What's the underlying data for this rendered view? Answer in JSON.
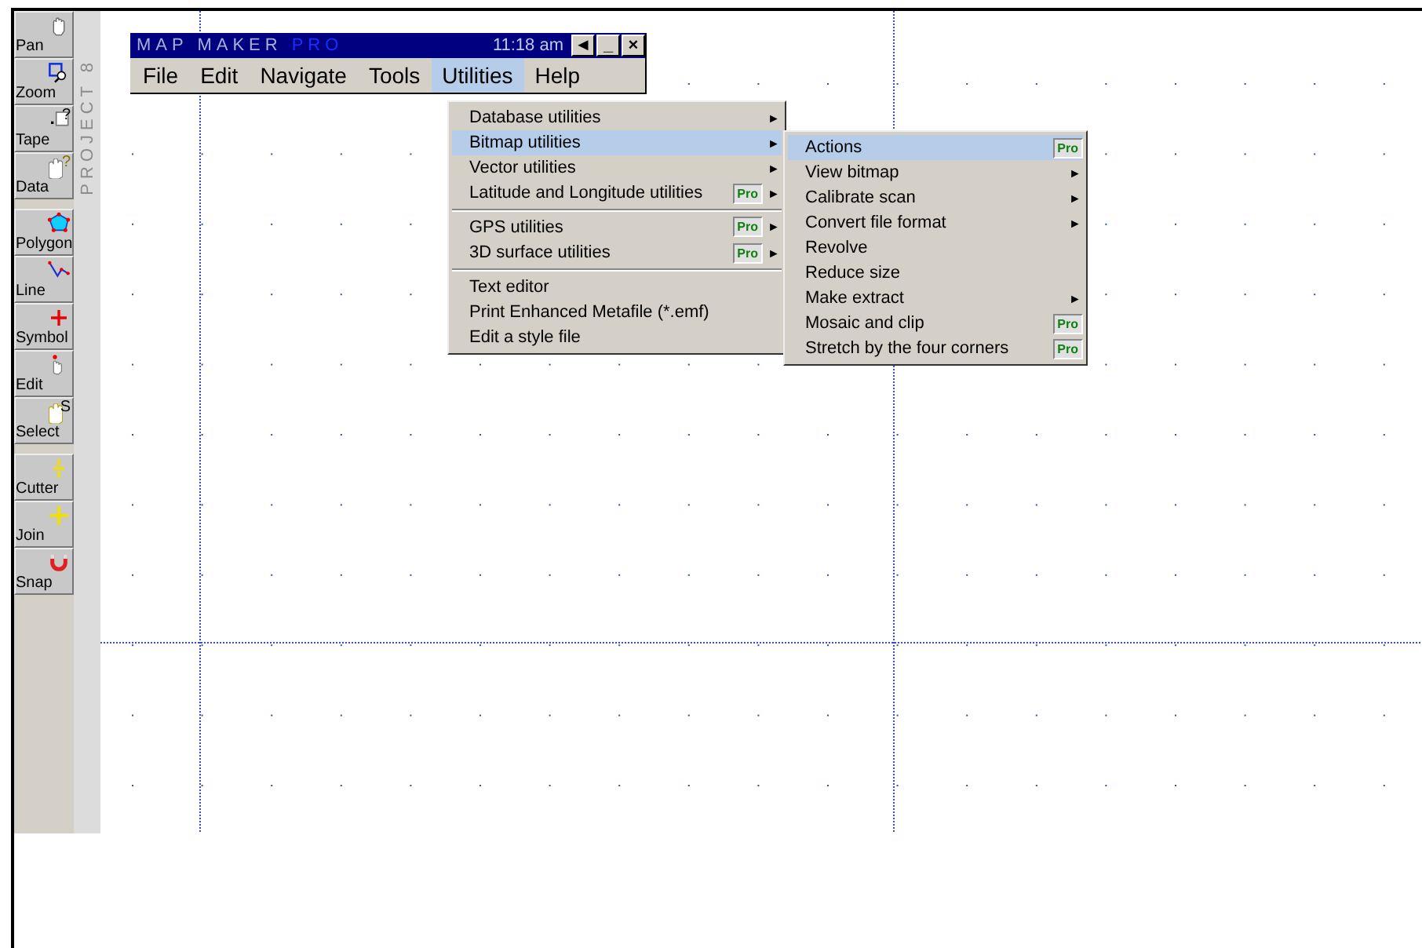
{
  "toolbar": {
    "groups": [
      {
        "buttons": [
          {
            "label": "Pan"
          },
          {
            "label": "Zoom"
          },
          {
            "label": "Tape",
            "badge": "?"
          },
          {
            "label": "Data",
            "badge": "?"
          }
        ]
      },
      {
        "buttons": [
          {
            "label": "Polygon"
          },
          {
            "label": "Line"
          },
          {
            "label": "Symbol"
          },
          {
            "label": "Edit"
          },
          {
            "label": "Select",
            "badge": "S"
          }
        ]
      },
      {
        "buttons": [
          {
            "label": "Cutter"
          },
          {
            "label": "Join"
          },
          {
            "label": "Snap"
          }
        ]
      }
    ]
  },
  "side_strip": {
    "label": "PROJECT 8"
  },
  "window": {
    "title": "MAP MAKER",
    "title_suffix": "PRO",
    "time": "11:18 am",
    "controls": [
      "◄",
      "_",
      "×"
    ]
  },
  "menu_bar": [
    {
      "label": "File",
      "selected": false
    },
    {
      "label": "Edit",
      "selected": false
    },
    {
      "label": "Navigate",
      "selected": false
    },
    {
      "label": "Tools",
      "selected": false
    },
    {
      "label": "Utilities",
      "selected": true
    },
    {
      "label": "Help",
      "selected": false
    }
  ],
  "utilities_menu": [
    {
      "label": "Database utilities",
      "submenu": true,
      "separator_before": false,
      "selected": false
    },
    {
      "label": "Bitmap utilities",
      "submenu": true,
      "separator_before": false,
      "selected": true
    },
    {
      "label": "Vector utilities",
      "submenu": true,
      "separator_before": false,
      "selected": false
    },
    {
      "label": "Latitude and Longitude utilities",
      "badge": "Pro",
      "submenu": true,
      "separator_before": false,
      "selected": false
    },
    {
      "label": "GPS utilities",
      "badge": "Pro",
      "submenu": true,
      "separator_before": true,
      "selected": false
    },
    {
      "label": "3D surface utilities",
      "badge": "Pro",
      "submenu": true,
      "separator_before": false,
      "selected": false
    },
    {
      "label": "Text editor",
      "submenu": false,
      "separator_before": true,
      "selected": false
    },
    {
      "label": "Print Enhanced Metafile (*.emf)",
      "submenu": false,
      "separator_before": false,
      "selected": false
    },
    {
      "label": "Edit a style file",
      "submenu": false,
      "separator_before": false,
      "selected": false
    }
  ],
  "bitmap_submenu": [
    {
      "label": "Actions",
      "badge": "Pro",
      "submenu": false,
      "selected": true
    },
    {
      "label": "View bitmap",
      "submenu": true,
      "selected": false
    },
    {
      "label": "Calibrate scan",
      "submenu": true,
      "selected": false
    },
    {
      "label": "Convert file format",
      "submenu": true,
      "selected": false
    },
    {
      "label": "Revolve",
      "submenu": false,
      "selected": false
    },
    {
      "label": "Reduce size",
      "submenu": false,
      "selected": false
    },
    {
      "label": "Make extract",
      "submenu": true,
      "selected": false
    },
    {
      "label": "Mosaic and clip",
      "badge": "Pro",
      "submenu": false,
      "selected": false
    },
    {
      "label": "Stretch by the four corners",
      "badge": "Pro",
      "submenu": false,
      "selected": false
    }
  ],
  "submenu_arrow": "►"
}
